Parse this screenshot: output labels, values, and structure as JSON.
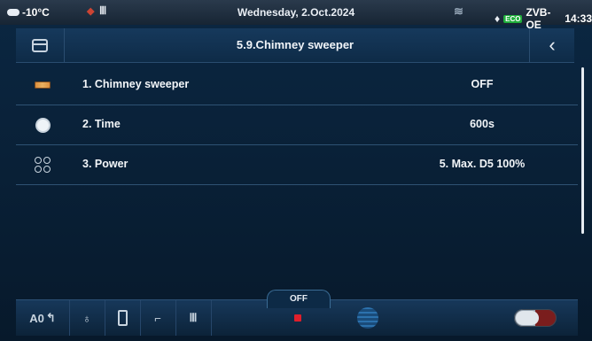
{
  "status_bar": {
    "temperature": "-10°C",
    "date": "Wednesday, 2.Oct.2024",
    "device": "ZVB-OE",
    "time": "14:33",
    "green_tag": "ECO"
  },
  "title_bar": {
    "title": "5.9.Chimney sweeper",
    "back_glyph": "‹"
  },
  "menu_rows": [
    {
      "label": "1.  Chimney sweeper",
      "value": "OFF",
      "icon": "boiler-icon"
    },
    {
      "label": "2.  Time",
      "value": "600s",
      "icon": "clock-icon"
    },
    {
      "label": "3.  Power",
      "value": "5. Max. D5 100%",
      "icon": "burner-icon"
    }
  ],
  "bottom_bar": {
    "mode_label": "A0",
    "stop_label": "OFF",
    "colors": {
      "stop": "#e01f2b",
      "accent": "#2f79b8"
    }
  }
}
